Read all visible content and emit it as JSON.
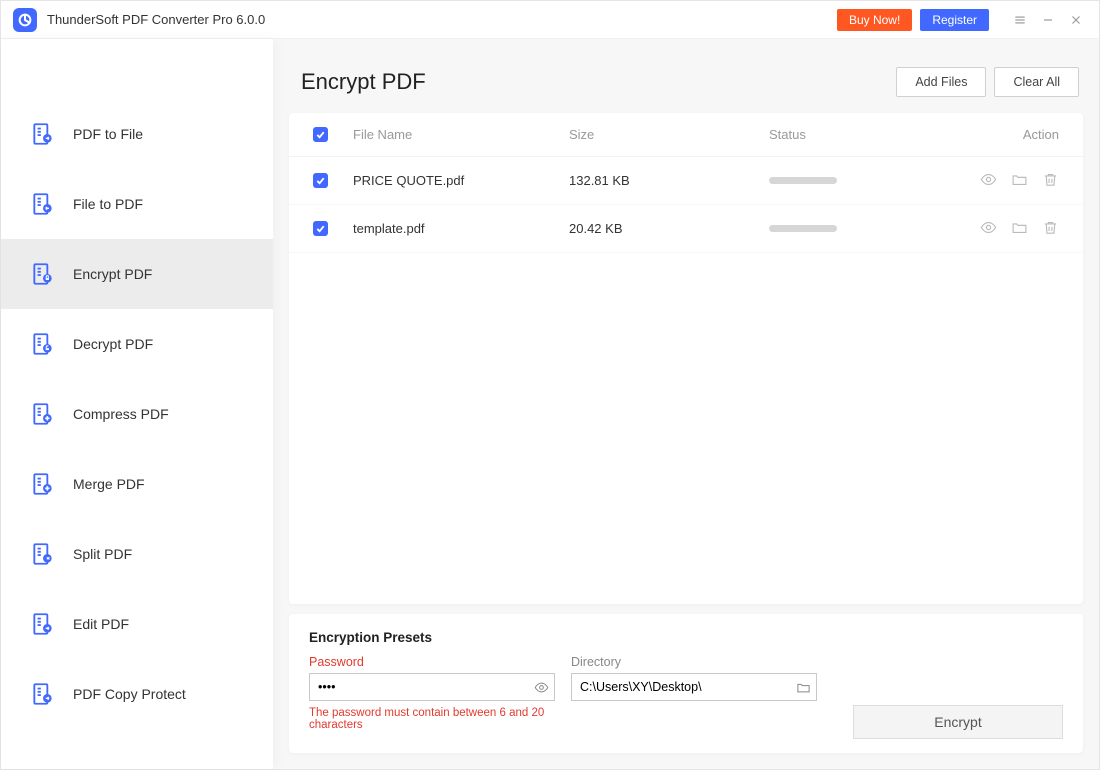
{
  "titlebar": {
    "app_title": "ThunderSoft PDF Converter Pro 6.0.0",
    "buynow": "Buy Now!",
    "register": "Register"
  },
  "sidebar": {
    "items": [
      {
        "label": "PDF to File"
      },
      {
        "label": "File to PDF"
      },
      {
        "label": "Encrypt PDF"
      },
      {
        "label": "Decrypt PDF"
      },
      {
        "label": "Compress PDF"
      },
      {
        "label": "Merge PDF"
      },
      {
        "label": "Split PDF"
      },
      {
        "label": "Edit PDF"
      },
      {
        "label": "PDF Copy Protect"
      }
    ],
    "active_index": 2
  },
  "main": {
    "title": "Encrypt PDF",
    "add_files": "Add Files",
    "clear_all": "Clear All",
    "columns": {
      "name": "File Name",
      "size": "Size",
      "status": "Status",
      "action": "Action"
    },
    "files": [
      {
        "name": "PRICE QUOTE.pdf",
        "size": "132.81 KB",
        "checked": true
      },
      {
        "name": "template.pdf",
        "size": "20.42 KB",
        "checked": true
      }
    ]
  },
  "presets": {
    "title": "Encryption Presets",
    "password_label": "Password",
    "password_value": "••••",
    "error_msg": "The password must contain between 6 and 20 characters",
    "directory_label": "Directory",
    "directory_value": "C:\\Users\\XY\\Desktop\\",
    "encrypt_button": "Encrypt"
  }
}
